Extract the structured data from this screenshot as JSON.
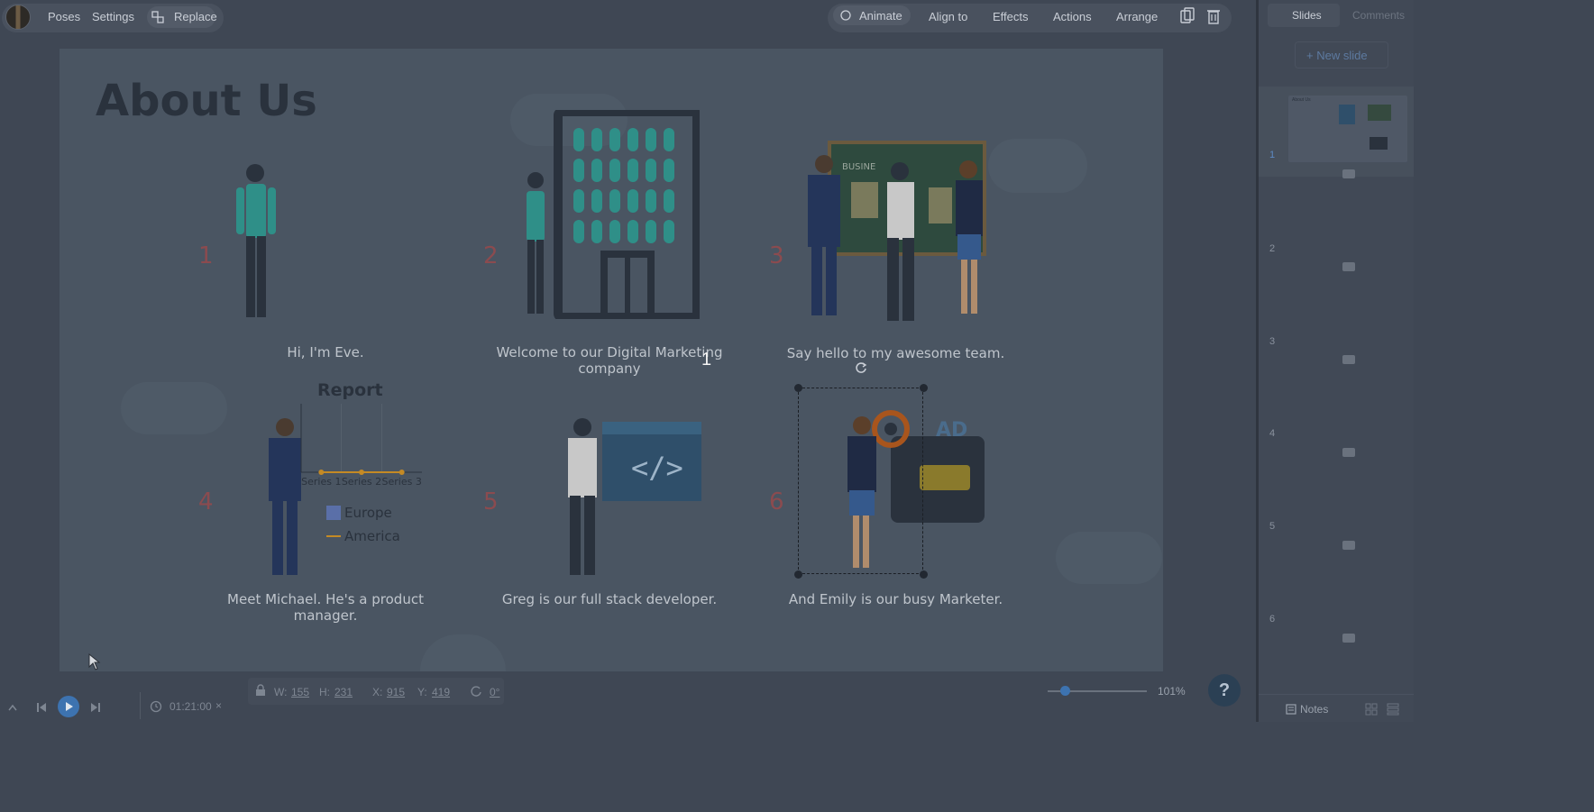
{
  "toolbar": {
    "left": {
      "poses": "Poses",
      "settings": "Settings",
      "replace": "Replace"
    },
    "right": {
      "animate": "Animate",
      "align_to": "Align to",
      "effects": "Effects",
      "actions": "Actions",
      "arrange": "Arrange"
    }
  },
  "panel": {
    "tabs": {
      "slides": "Slides",
      "comments": "Comments"
    },
    "new_slide": "+ New slide",
    "thumbnails": [
      {
        "num": "1",
        "label": "About Us"
      },
      {
        "num": "2"
      },
      {
        "num": "3"
      },
      {
        "num": "4"
      },
      {
        "num": "5"
      },
      {
        "num": "6"
      }
    ],
    "notes": "Notes"
  },
  "slide": {
    "title": "About Us",
    "items": [
      {
        "num": "1",
        "caption": "Hi, I'm Eve."
      },
      {
        "num": "2",
        "caption": "Welcome to our Digital Marketing company"
      },
      {
        "num": "3",
        "caption": "Say hello to my awesome team."
      },
      {
        "num": "4",
        "caption": "Meet Michael. He's a product manager."
      },
      {
        "num": "5",
        "caption": "Greg is our full stack developer."
      },
      {
        "num": "6",
        "caption": "And Emily is our busy Marketer."
      }
    ],
    "board_text": "BUSINE",
    "ad_text": "AD",
    "selection_number": "1"
  },
  "chart_data": {
    "type": "line",
    "title": "Report",
    "categories": [
      "Series 1",
      "Series 2",
      "Series 3"
    ],
    "legend": [
      {
        "name": "Europe",
        "color": "#5a6fa8"
      },
      {
        "name": "America",
        "color": "#c48a25"
      }
    ],
    "series": [
      {
        "name": "America",
        "values": [
          0,
          0,
          0
        ]
      }
    ]
  },
  "bottom": {
    "time": "01:21:00",
    "w_label": "W:",
    "w_value": "155",
    "h_label": "H:",
    "h_value": "231",
    "x_label": "X:",
    "x_value": "915",
    "y_label": "Y:",
    "y_value": "419",
    "rotation": "0°",
    "zoom": "101%",
    "help": "?"
  },
  "colors": {
    "accent": "#3d73b0",
    "number": "#8b4b4f",
    "teal": "#2f8f88"
  }
}
